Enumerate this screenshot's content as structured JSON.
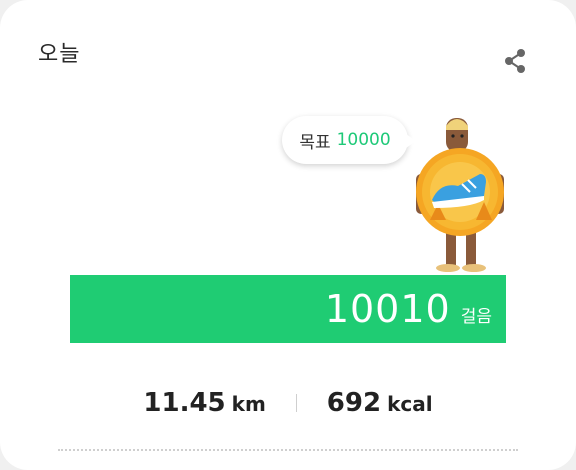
{
  "header": {
    "title": "오늘",
    "share_icon": "share-icon"
  },
  "goal": {
    "label": "목표",
    "value": "10000"
  },
  "steps": {
    "count": "10010",
    "unit": "걸음",
    "progress_fraction": 1.0
  },
  "stats": {
    "distance_value": "11.45",
    "distance_unit": "km",
    "calories_value": "692",
    "calories_unit": "kcal"
  },
  "colors": {
    "accent": "#1fcc73",
    "goal_text": "#1ec978"
  }
}
